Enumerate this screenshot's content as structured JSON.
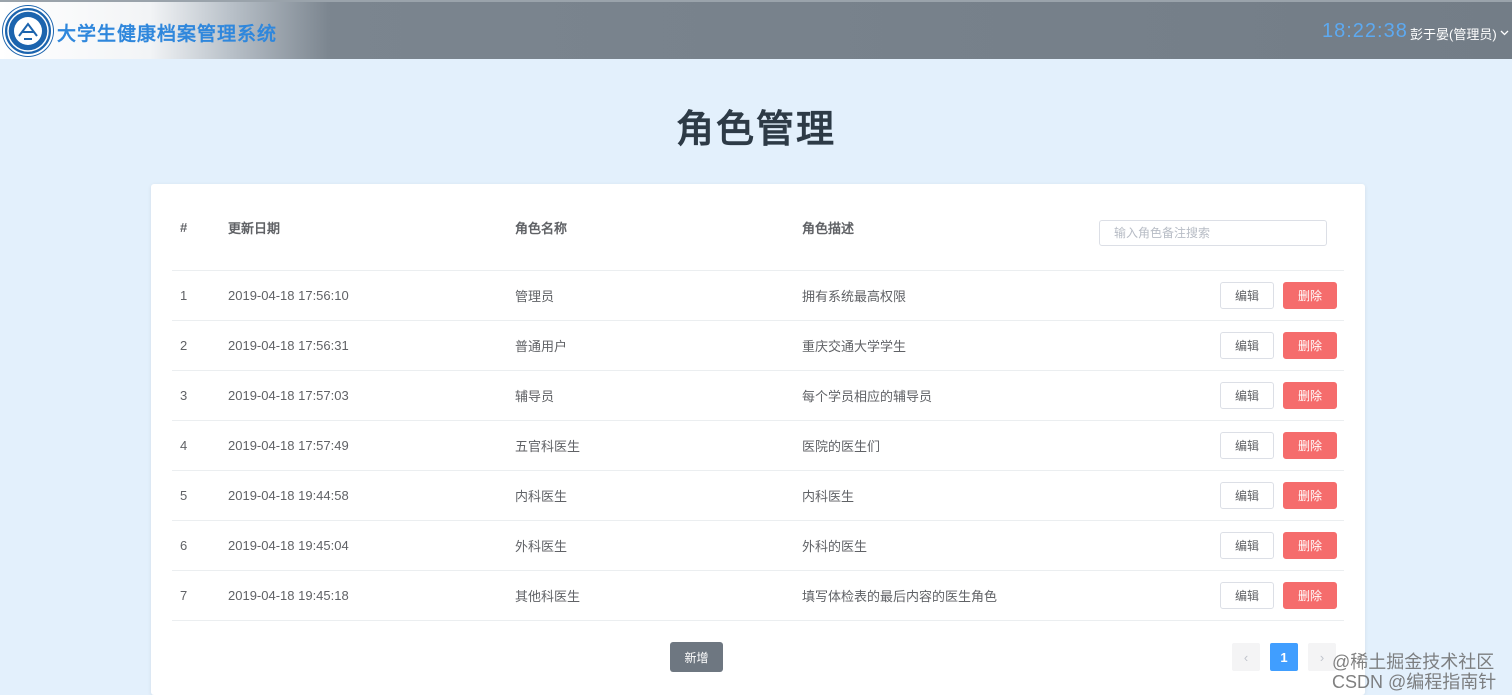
{
  "header": {
    "app_title": "大学生健康档案管理系统",
    "time": "18:22:38",
    "user": "彭于晏(管理员)",
    "user_icon": "chevron-down-icon"
  },
  "page": {
    "title": "角色管理"
  },
  "table": {
    "columns": [
      "#",
      "更新日期",
      "角色名称",
      "角色描述"
    ],
    "search_placeholder": "输入角色备注搜索",
    "edit_label": "编辑",
    "delete_label": "删除",
    "rows": [
      {
        "idx": "1",
        "date": "2019-04-18 17:56:10",
        "name": "管理员",
        "desc": "拥有系统最高权限"
      },
      {
        "idx": "2",
        "date": "2019-04-18 17:56:31",
        "name": "普通用户",
        "desc": "重庆交通大学学生"
      },
      {
        "idx": "3",
        "date": "2019-04-18 17:57:03",
        "name": "辅导员",
        "desc": "每个学员相应的辅导员"
      },
      {
        "idx": "4",
        "date": "2019-04-18 17:57:49",
        "name": "五官科医生",
        "desc": "医院的医生们"
      },
      {
        "idx": "5",
        "date": "2019-04-18 19:44:58",
        "name": "内科医生",
        "desc": "内科医生"
      },
      {
        "idx": "6",
        "date": "2019-04-18 19:45:04",
        "name": "外科医生",
        "desc": "外科的医生"
      },
      {
        "idx": "7",
        "date": "2019-04-18 19:45:18",
        "name": "其他科医生",
        "desc": "填写体检表的最后内容的医生角色"
      }
    ]
  },
  "footer": {
    "add_label": "新增",
    "pagination": {
      "prev": "‹",
      "current": "1",
      "next": "›"
    }
  },
  "watermark": {
    "line1": "@稀土掘金技术社区",
    "line2": "CSDN @编程指南针"
  },
  "colors": {
    "accent": "#409eff",
    "danger": "#f56c6c",
    "header": "#737d87",
    "background": "#e3f0fc"
  }
}
